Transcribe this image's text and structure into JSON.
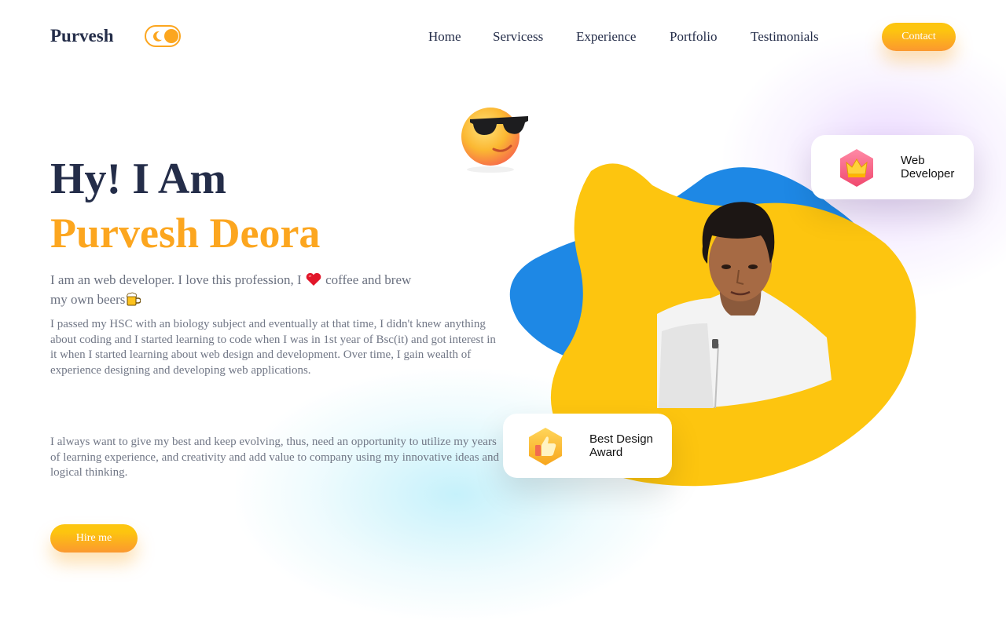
{
  "brand": {
    "name": "Purvesh"
  },
  "theme_toggle": {
    "icon": "moon-icon",
    "accent": "#fca61f"
  },
  "nav": {
    "items": [
      {
        "label": "Home"
      },
      {
        "label": "Servicess"
      },
      {
        "label": "Experience"
      },
      {
        "label": "Portfolio"
      },
      {
        "label": "Testimonials"
      }
    ],
    "contact_label": "Contact"
  },
  "hero": {
    "greeting": "Hy! I Am",
    "name": "Purvesh Deora",
    "intro_part1": "I am an web developer. I love this profession, I ",
    "intro_icon_heart": "heart-icon",
    "intro_part2": " coffee and brew my own beers",
    "intro_icon_beer": "beer-mug-icon",
    "paragraph1": "I passed my HSC with an biology subject and eventually at that time, I didn't knew anything about coding and I started learning to code when I was in 1st year of Bsc(it) and got interest in it when I started learning about web design and development. Over time, I gain wealth of experience designing and developing web applications.",
    "paragraph2": "I always want to give my best and keep evolving, thus, need an opportunity to utilize my years of learning experience, and creativity and add value to company using my innovative ideas and logical thinking.",
    "hire_label": "Hire me"
  },
  "cards": {
    "web_developer": {
      "line1": "Web",
      "line2": "Developer",
      "icon": "crown-icon"
    },
    "best_design": {
      "line1": "Best Design",
      "line2": "Award",
      "icon": "thumbs-up-icon"
    }
  },
  "decor": {
    "emoji": "sunglasses-emoji-icon",
    "photo": "profile-photo"
  },
  "colors": {
    "primary_text": "#242d49",
    "accent_orange": "#fca61f",
    "blob_yellow": "#fdc50f",
    "blob_blue": "#1e88e5",
    "body_text": "#717786"
  }
}
